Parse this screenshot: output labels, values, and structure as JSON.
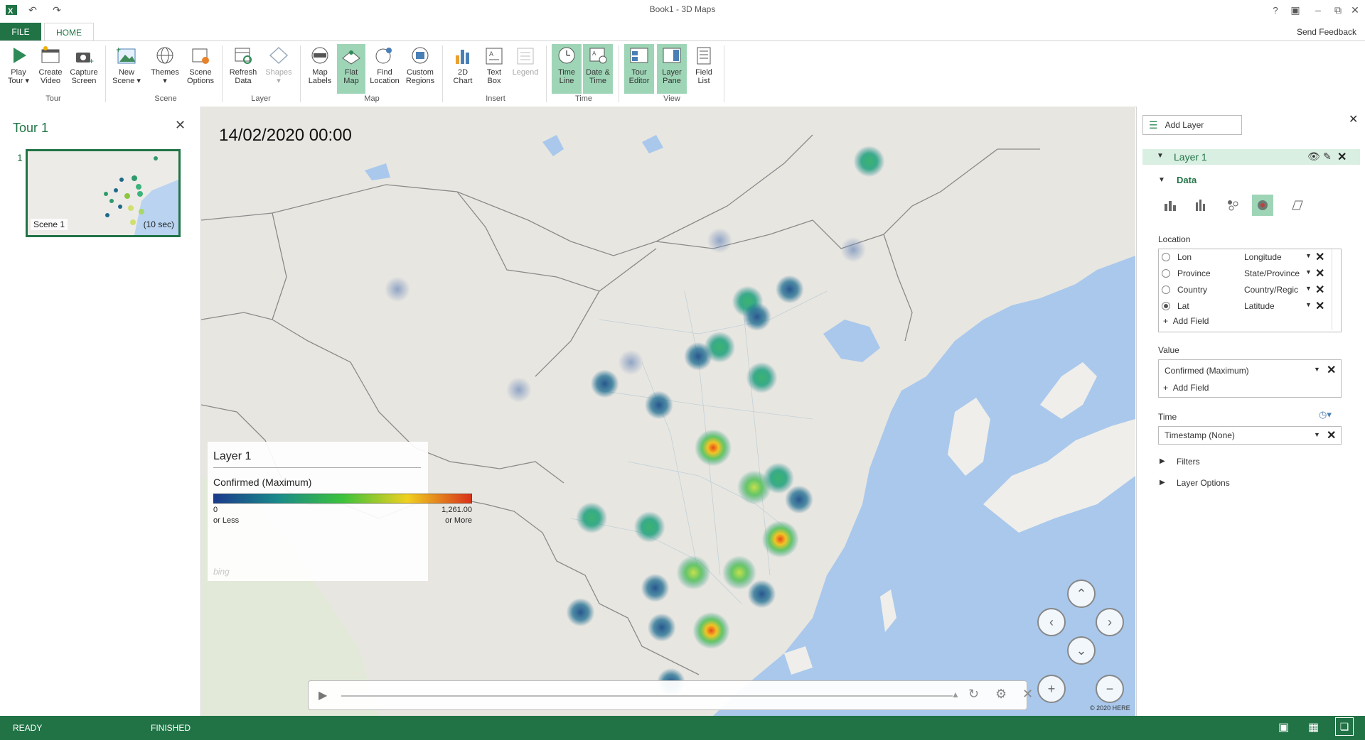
{
  "window": {
    "title": "Book1 - 3D Maps"
  },
  "tabs": {
    "file": "FILE",
    "home": "HOME",
    "send_feedback": "Send Feedback"
  },
  "ribbon": {
    "buttons": [
      {
        "id": "play-tour",
        "l1": "Play",
        "l2": "Tour ▾"
      },
      {
        "id": "create-video",
        "l1": "Create",
        "l2": "Video"
      },
      {
        "id": "capture-screen",
        "l1": "Capture",
        "l2": "Screen"
      },
      {
        "id": "new-scene",
        "l1": "New",
        "l2": "Scene ▾"
      },
      {
        "id": "themes",
        "l1": "Themes",
        "l2": "▾"
      },
      {
        "id": "scene-options",
        "l1": "Scene",
        "l2": "Options"
      },
      {
        "id": "refresh-data",
        "l1": "Refresh",
        "l2": "Data"
      },
      {
        "id": "shapes",
        "l1": "Shapes",
        "l2": "▾"
      },
      {
        "id": "map-labels",
        "l1": "Map",
        "l2": "Labels"
      },
      {
        "id": "flat-map",
        "l1": "Flat",
        "l2": "Map"
      },
      {
        "id": "find-location",
        "l1": "Find",
        "l2": "Location"
      },
      {
        "id": "custom-regions",
        "l1": "Custom",
        "l2": "Regions"
      },
      {
        "id": "2d-chart",
        "l1": "2D",
        "l2": "Chart"
      },
      {
        "id": "text-box",
        "l1": "Text",
        "l2": "Box"
      },
      {
        "id": "legend",
        "l1": "Legend",
        "l2": ""
      },
      {
        "id": "time-line",
        "l1": "Time",
        "l2": "Line"
      },
      {
        "id": "date-time",
        "l1": "Date &",
        "l2": "Time"
      },
      {
        "id": "tour-editor",
        "l1": "Tour",
        "l2": "Editor"
      },
      {
        "id": "layer-pane",
        "l1": "Layer",
        "l2": "Pane"
      },
      {
        "id": "field-list",
        "l1": "Field",
        "l2": "List"
      }
    ],
    "groups": [
      "Tour",
      "Scene",
      "Layer",
      "Map",
      "Insert",
      "Time",
      "View"
    ]
  },
  "tour": {
    "title": "Tour 1",
    "scene_number": "1",
    "scene_name": "Scene 1",
    "scene_duration": "(10 sec)"
  },
  "map": {
    "timestamp": "14/02/2020 00:00",
    "copyright": "© 2020 HERE",
    "bing": "bing",
    "legend": {
      "title": "Layer 1",
      "subtitle": "Confirmed (Maximum)",
      "min_value": "0",
      "min_note": "or Less",
      "max_value": "1,261.00",
      "max_note": "or More"
    },
    "heat_points": [
      {
        "lon": 0.715,
        "lat": 0.09,
        "level": 0.35
      },
      {
        "lon": 0.555,
        "lat": 0.22,
        "level": 0.0,
        "faded": true
      },
      {
        "lon": 0.698,
        "lat": 0.235,
        "level": 0.0,
        "faded": true
      },
      {
        "lon": 0.21,
        "lat": 0.3,
        "level": 0.0,
        "faded": true
      },
      {
        "lon": 0.63,
        "lat": 0.3,
        "level": 0.1
      },
      {
        "lon": 0.585,
        "lat": 0.32,
        "level": 0.35
      },
      {
        "lon": 0.595,
        "lat": 0.345,
        "level": 0.05
      },
      {
        "lon": 0.555,
        "lat": 0.395,
        "level": 0.3
      },
      {
        "lon": 0.532,
        "lat": 0.41,
        "level": 0.1
      },
      {
        "lon": 0.46,
        "lat": 0.42,
        "level": 0.0,
        "faded": true
      },
      {
        "lon": 0.6,
        "lat": 0.445,
        "level": 0.4
      },
      {
        "lon": 0.432,
        "lat": 0.455,
        "level": 0.05
      },
      {
        "lon": 0.34,
        "lat": 0.465,
        "level": 0.0,
        "faded": true
      },
      {
        "lon": 0.49,
        "lat": 0.49,
        "level": 0.2
      },
      {
        "lon": 0.548,
        "lat": 0.56,
        "level": 0.9
      },
      {
        "lon": 0.618,
        "lat": 0.61,
        "level": 0.4
      },
      {
        "lon": 0.592,
        "lat": 0.625,
        "level": 0.75
      },
      {
        "lon": 0.64,
        "lat": 0.645,
        "level": 0.1
      },
      {
        "lon": 0.418,
        "lat": 0.675,
        "level": 0.35
      },
      {
        "lon": 0.48,
        "lat": 0.69,
        "level": 0.4
      },
      {
        "lon": 0.62,
        "lat": 0.71,
        "level": 0.95
      },
      {
        "lon": 0.527,
        "lat": 0.765,
        "level": 0.75
      },
      {
        "lon": 0.576,
        "lat": 0.765,
        "level": 0.7
      },
      {
        "lon": 0.486,
        "lat": 0.79,
        "level": 0.05
      },
      {
        "lon": 0.6,
        "lat": 0.8,
        "level": 0.2
      },
      {
        "lon": 0.406,
        "lat": 0.83,
        "level": 0.05
      },
      {
        "lon": 0.493,
        "lat": 0.855,
        "level": 0.2
      },
      {
        "lon": 0.546,
        "lat": 0.86,
        "level": 0.95
      },
      {
        "lon": 0.503,
        "lat": 0.945,
        "level": 0.05
      }
    ]
  },
  "pane": {
    "add_layer": "Add Layer",
    "layer_name": "Layer 1",
    "data_label": "Data",
    "location_label": "Location",
    "location_fields": [
      {
        "name": "Lon",
        "type": "Longitude",
        "selected": false
      },
      {
        "name": "Province",
        "type": "State/Province",
        "selected": false
      },
      {
        "name": "Country",
        "type": "Country/Regic",
        "selected": false
      },
      {
        "name": "Lat",
        "type": "Latitude",
        "selected": true
      }
    ],
    "add_field": "Add Field",
    "value_label": "Value",
    "value_field": "Confirmed (Maximum)",
    "time_label": "Time",
    "time_field": "Timestamp (None)",
    "filters": "Filters",
    "layer_options": "Layer Options"
  },
  "status": {
    "ready": "READY",
    "finished": "FINISHED"
  },
  "colors": {
    "brand": "#217346",
    "active": "#9fd5b7",
    "water": "#a9c8ec",
    "land": "#e8e6e1"
  }
}
